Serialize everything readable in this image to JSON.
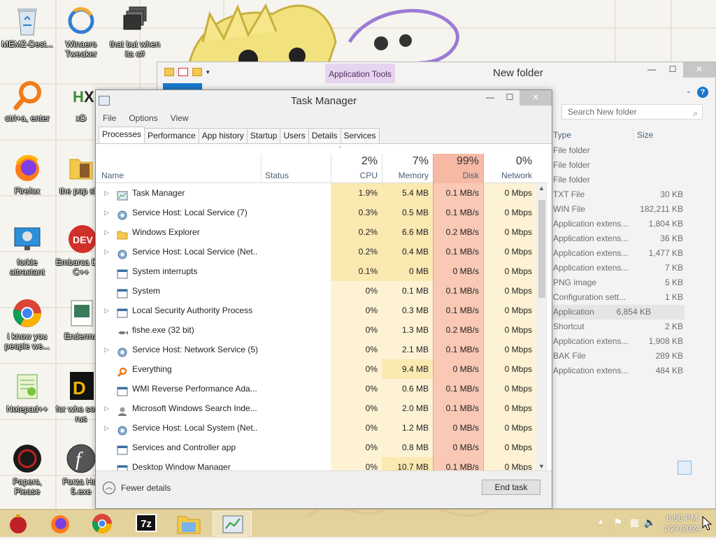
{
  "desktop": {
    "icons": [
      {
        "label": "MEMZ-Dest...",
        "icon": "recycle-bin-icon"
      },
      {
        "label": "Winaero Tweaker",
        "icon": "winaero-icon"
      },
      {
        "label": "that but when its c#",
        "icon": "windows-stack-icon"
      },
      {
        "label": "ctrl+a, enter",
        "icon": "magnifier-icon"
      },
      {
        "label": "xD",
        "icon": "hex-editor-icon"
      },
      {
        "label": "Firefox",
        "icon": "firefox-icon"
      },
      {
        "label": "the pop shit",
        "icon": "folder-icon"
      },
      {
        "label": "forkie attractant",
        "icon": "monitor-gear-icon"
      },
      {
        "label": "Embarca Dev C++",
        "icon": "devcpp-icon"
      },
      {
        "label": "i know you people we...",
        "icon": "chrome-icon"
      },
      {
        "label": "Enderma",
        "icon": "image-file-icon"
      },
      {
        "label": "Notepad++",
        "icon": "notepadpp-icon"
      },
      {
        "label": "for who some rus",
        "icon": "dj-app-icon"
      },
      {
        "label": "Papers, Please",
        "icon": "papers-please-icon"
      },
      {
        "label": "Forza Hor 5.exe",
        "icon": "flash-icon"
      }
    ]
  },
  "explorer": {
    "title": "New folder",
    "context_tab": "Application Tools",
    "search_placeholder": "Search New folder",
    "columns": {
      "type": "Type",
      "size": "Size"
    },
    "rows": [
      {
        "type": "File folder",
        "size": ""
      },
      {
        "type": "File folder",
        "size": ""
      },
      {
        "type": "File folder",
        "size": ""
      },
      {
        "type": "TXT File",
        "size": "30 KB"
      },
      {
        "type": "WIN File",
        "size": "182,211 KB"
      },
      {
        "type": "Application extens...",
        "size": "1,804 KB"
      },
      {
        "type": "Application extens...",
        "size": "36 KB"
      },
      {
        "type": "Application extens...",
        "size": "1,477 KB"
      },
      {
        "type": "Application extens...",
        "size": "7 KB"
      },
      {
        "type": "PNG image",
        "size": "5 KB"
      },
      {
        "type": "Configuration sett...",
        "size": "1 KB"
      },
      {
        "type": "Application",
        "size": "6,854 KB"
      },
      {
        "type": "Shortcut",
        "size": "2 KB"
      },
      {
        "type": "Application extens...",
        "size": "1,908 KB"
      },
      {
        "type": "BAK File",
        "size": "289 KB"
      },
      {
        "type": "Application extens...",
        "size": "484 KB"
      }
    ],
    "selected_row": 11
  },
  "taskmanager": {
    "title": "Task Manager",
    "menu": [
      "File",
      "Options",
      "View"
    ],
    "tabs": [
      "Processes",
      "Performance",
      "App history",
      "Startup",
      "Users",
      "Details",
      "Services"
    ],
    "active_tab": 0,
    "header": {
      "name": "Name",
      "status": "Status",
      "cpu_pct": "2%",
      "cpu": "CPU",
      "mem_pct": "7%",
      "mem": "Memory",
      "disk_pct": "99%",
      "disk": "Disk",
      "net_pct": "0%",
      "net": "Network"
    },
    "processes": [
      {
        "name": "Task Manager",
        "expand": true,
        "icon": "taskmanager-icon",
        "cpu": "1.9%",
        "mem": "5.4 MB",
        "disk": "0.1 MB/s",
        "net": "0 Mbps"
      },
      {
        "name": "Service Host: Local Service (7)",
        "expand": true,
        "icon": "gear-icon",
        "cpu": "0.3%",
        "mem": "0.5 MB",
        "disk": "0.1 MB/s",
        "net": "0 Mbps"
      },
      {
        "name": "Windows Explorer",
        "expand": true,
        "icon": "folder-icon",
        "cpu": "0.2%",
        "mem": "6.6 MB",
        "disk": "0.2 MB/s",
        "net": "0 Mbps"
      },
      {
        "name": "Service Host: Local Service (Net...",
        "expand": true,
        "icon": "gear-icon",
        "cpu": "0.2%",
        "mem": "0.4 MB",
        "disk": "0.1 MB/s",
        "net": "0 Mbps"
      },
      {
        "name": "System interrupts",
        "expand": false,
        "icon": "window-icon",
        "cpu": "0.1%",
        "mem": "0 MB",
        "disk": "0 MB/s",
        "net": "0 Mbps"
      },
      {
        "name": "System",
        "expand": false,
        "icon": "window-icon",
        "cpu": "0%",
        "mem": "0.1 MB",
        "disk": "0.1 MB/s",
        "net": "0 Mbps"
      },
      {
        "name": "Local Security Authority Process",
        "expand": true,
        "icon": "window-icon",
        "cpu": "0%",
        "mem": "0.3 MB",
        "disk": "0.1 MB/s",
        "net": "0 Mbps"
      },
      {
        "name": "fishe.exe (32 bit)",
        "expand": false,
        "icon": "fish-icon",
        "cpu": "0%",
        "mem": "1.3 MB",
        "disk": "0.2 MB/s",
        "net": "0 Mbps"
      },
      {
        "name": "Service Host: Network Service (5)",
        "expand": true,
        "icon": "gear-icon",
        "cpu": "0%",
        "mem": "2.1 MB",
        "disk": "0.1 MB/s",
        "net": "0 Mbps"
      },
      {
        "name": "Everything",
        "expand": false,
        "icon": "magnifier-icon",
        "cpu": "0%",
        "mem": "9.4 MB",
        "disk": "0 MB/s",
        "net": "0 Mbps"
      },
      {
        "name": "WMI Reverse Performance Ada...",
        "expand": false,
        "icon": "window-icon",
        "cpu": "0%",
        "mem": "0.6 MB",
        "disk": "0.1 MB/s",
        "net": "0 Mbps"
      },
      {
        "name": "Microsoft Windows Search Inde...",
        "expand": true,
        "icon": "search-user-icon",
        "cpu": "0%",
        "mem": "2.0 MB",
        "disk": "0.1 MB/s",
        "net": "0 Mbps"
      },
      {
        "name": "Service Host: Local System (Net...",
        "expand": true,
        "icon": "gear-icon",
        "cpu": "0%",
        "mem": "1.2 MB",
        "disk": "0 MB/s",
        "net": "0 Mbps"
      },
      {
        "name": "Services and Controller app",
        "expand": false,
        "icon": "window-icon",
        "cpu": "0%",
        "mem": "0.8 MB",
        "disk": "0 MB/s",
        "net": "0 Mbps"
      },
      {
        "name": "Desktop Window Manager",
        "expand": false,
        "icon": "window-icon",
        "cpu": "0%",
        "mem": "10.7 MB",
        "disk": "0.1 MB/s",
        "net": "0 Mbps"
      }
    ],
    "footer": {
      "fewer": "Fewer details",
      "end_task": "End task"
    }
  },
  "taskbar": {
    "apps": [
      "ornament-icon",
      "firefox-icon",
      "chrome-icon",
      "7zip-icon",
      "file-explorer-icon",
      "taskmanager-icon"
    ],
    "active_app": 5,
    "sevenzip_label": "7z",
    "time": "6:56 PM",
    "date": "1/27/2024"
  },
  "colors": {
    "heat_strong": "#fbe9b2",
    "heat_light": "#fdf3d4",
    "disk_hot": "#f9c9b6",
    "disk_header": "#f6b9a4",
    "accent": "#1979ca"
  }
}
